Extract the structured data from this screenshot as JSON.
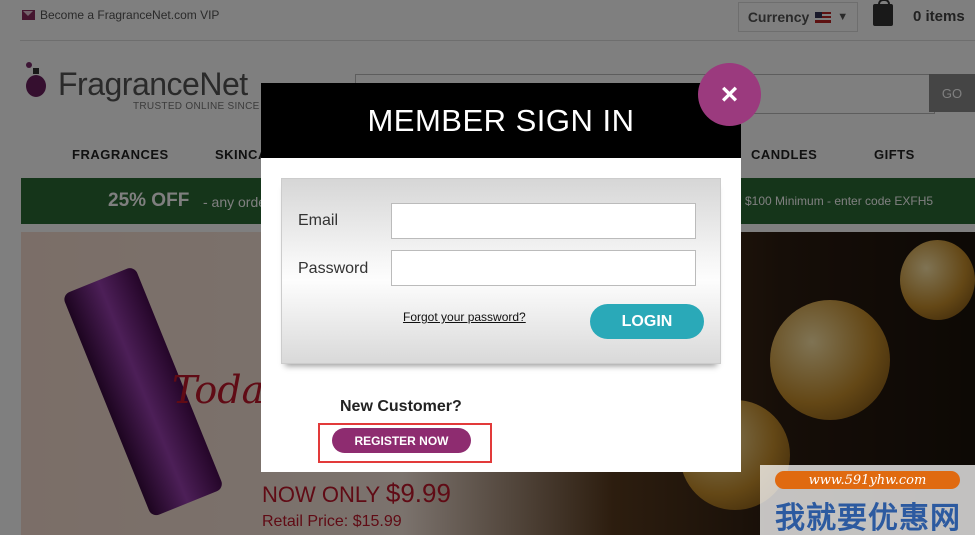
{
  "topbar": {
    "vip_text": "Become a FragranceNet.com VIP",
    "currency_label": "Currency",
    "currency_arrow": "▼",
    "cart_items": "0 items"
  },
  "header": {
    "logo_text": "FragranceNet",
    "tagline": "TRUSTED ONLINE SINCE",
    "search_placeholder": "",
    "go_label": "GO"
  },
  "nav": {
    "items": [
      "FRAGRANCES",
      "SKINCA",
      "CANDLES",
      "GIFTS"
    ]
  },
  "promo": {
    "percent": "25% OFF",
    "text": "- any orde",
    "right_text": "$100 Minimum - enter code EXFH5",
    "color": "#2a6b35"
  },
  "hero": {
    "script_text": "Today",
    "now_only_label": "NOW ONLY",
    "now_only_price": "$9.99",
    "retail_price": "Retail Price: $15.99"
  },
  "watermark": {
    "url": "www.591yhw.com",
    "chinese": "我就要优惠网"
  },
  "modal": {
    "title": "MEMBER SIGN IN",
    "close_symbol": "×",
    "email_label": "Email",
    "password_label": "Password",
    "email_value": "",
    "password_value": "",
    "forgot_label": "Forgot your password?",
    "login_label": "LOGIN",
    "new_customer_label": "New Customer?",
    "register_label": "REGISTER NOW",
    "accent_color": "#9b3a7e",
    "login_color": "#2aa9b8"
  }
}
